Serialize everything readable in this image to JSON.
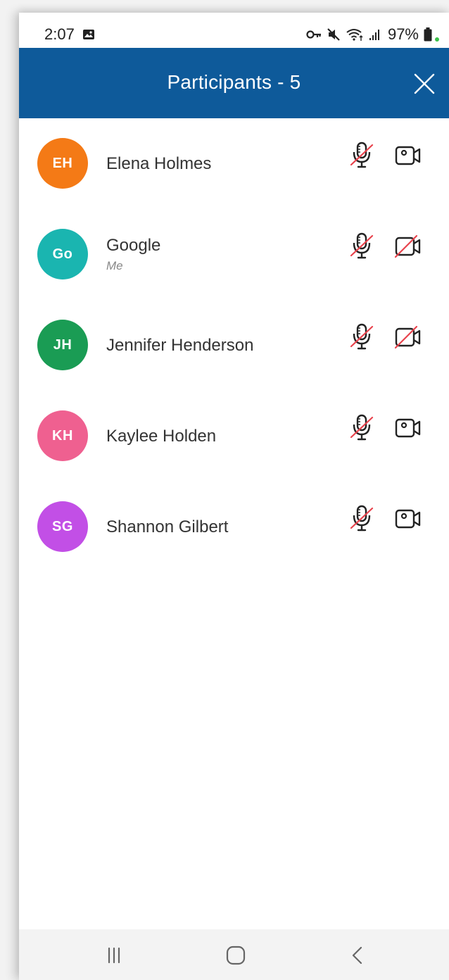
{
  "status_bar": {
    "time": "2:07",
    "battery_percent": "97%",
    "icons": [
      "image-icon",
      "key-icon",
      "mute-icon",
      "wifi-icon",
      "signal-icon",
      "battery-icon"
    ]
  },
  "header": {
    "title": "Participants - 5",
    "background": "#0e5a9a"
  },
  "participants": [
    {
      "initials": "EH",
      "name": "Elena Holmes",
      "subtitle": "",
      "avatar_color": "#f47a16",
      "mic_muted": true,
      "camera_off": false
    },
    {
      "initials": "Go",
      "name": "Google",
      "subtitle": "Me",
      "avatar_color": "#1ab5b0",
      "mic_muted": true,
      "camera_off": true
    },
    {
      "initials": "JH",
      "name": "Jennifer Henderson",
      "subtitle": "",
      "avatar_color": "#1a9c54",
      "mic_muted": true,
      "camera_off": true
    },
    {
      "initials": "KH",
      "name": "Kaylee Holden",
      "subtitle": "",
      "avatar_color": "#ef6090",
      "mic_muted": true,
      "camera_off": false
    },
    {
      "initials": "SG",
      "name": "Shannon Gilbert",
      "subtitle": "",
      "avatar_color": "#c24fe6",
      "mic_muted": true,
      "camera_off": false
    }
  ],
  "nav_bar": {
    "icons": [
      "recent-apps-icon",
      "home-icon",
      "back-icon"
    ]
  }
}
